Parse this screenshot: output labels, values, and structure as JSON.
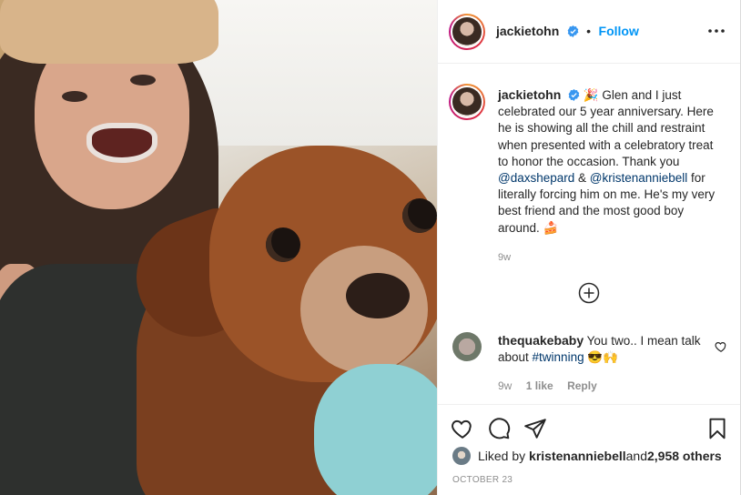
{
  "post": {
    "username": "jackietohn",
    "follow_label": "Follow",
    "separator": "•"
  },
  "caption": {
    "username": "jackietohn",
    "emoji_start": "🎉",
    "text_1": "Glen and I just celebrated our 5 year anniversary. Here he is showing all the chill and restraint when presented with a celebratory treat to honor the occasion. Thank you ",
    "mention_1": "@daxshepard",
    "text_2": " & ",
    "mention_2": "@kristenanniebell",
    "text_3": " for literally forcing him on me. He's my very best friend and the most good boy around. ",
    "emoji_end": "🍰",
    "time": "9w"
  },
  "comment": {
    "username": "thequakebaby",
    "text": "You two.. I mean talk about ",
    "hashtag": "#twinning",
    "emoji": "😎🙌",
    "time": "9w",
    "likes": "1 like",
    "reply_label": "Reply"
  },
  "likes": {
    "prefix": "Liked by ",
    "user": "kristenanniebell",
    "middle": " and ",
    "others": "2,958 others"
  },
  "date": "OCTOBER 23",
  "icons": {
    "header_more": "more-horizontal-icon",
    "verified": "verified-badge-icon",
    "load_more": "plus-circle-icon",
    "comment_like": "heart-icon",
    "like": "heart-icon",
    "comment": "comment-bubble-icon",
    "share": "paper-plane-icon",
    "save": "bookmark-icon"
  },
  "colors": {
    "follow": "#0095f6",
    "verified": "#3897f0",
    "link": "#00376b",
    "meta": "#8e8e8e"
  }
}
